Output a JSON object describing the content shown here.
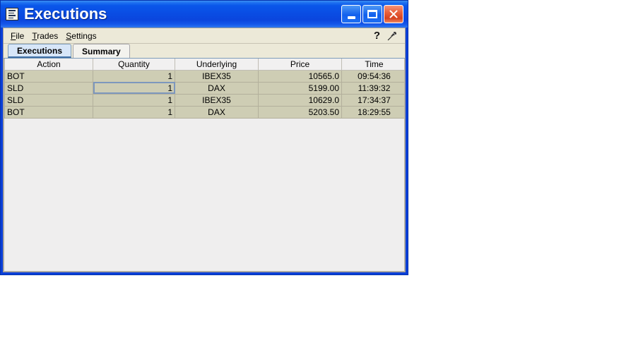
{
  "window": {
    "title": "Executions",
    "icon": "document-list-icon",
    "controls": {
      "minimize_label": "Minimize",
      "maximize_label": "Maximize",
      "close_label": "Close"
    }
  },
  "menu": {
    "items": [
      {
        "label": "File",
        "mnemonic": "F"
      },
      {
        "label": "Trades",
        "mnemonic": "T"
      },
      {
        "label": "Settings",
        "mnemonic": "S"
      }
    ],
    "help_icon": "?",
    "pin_icon": "pushpin-icon"
  },
  "tabs": [
    {
      "label": "Executions",
      "active": true
    },
    {
      "label": "Summary",
      "active": false
    }
  ],
  "table": {
    "columns": [
      "Action",
      "Quantity",
      "Underlying",
      "Price",
      "Time"
    ],
    "rows": [
      {
        "action": "BOT",
        "quantity": "1",
        "underlying": "IBEX35",
        "price": "10565.0",
        "time": "09:54:36"
      },
      {
        "action": "SLD",
        "quantity": "1",
        "underlying": "DAX",
        "price": "5199.00",
        "time": "11:39:32"
      },
      {
        "action": "SLD",
        "quantity": "1",
        "underlying": "IBEX35",
        "price": "10629.0",
        "time": "17:34:37"
      },
      {
        "action": "BOT",
        "quantity": "1",
        "underlying": "DAX",
        "price": "5203.50",
        "time": "18:29:55"
      }
    ],
    "selected_cell": {
      "row": 1,
      "column": "quantity"
    }
  },
  "colors": {
    "titlebar_blue": "#0a4de4",
    "row_background": "#cecdb4",
    "header_background": "#f1f0f0",
    "active_tab": "#d7e6f8",
    "close_button": "#d6421f",
    "selection_border": "#7d97bd"
  }
}
